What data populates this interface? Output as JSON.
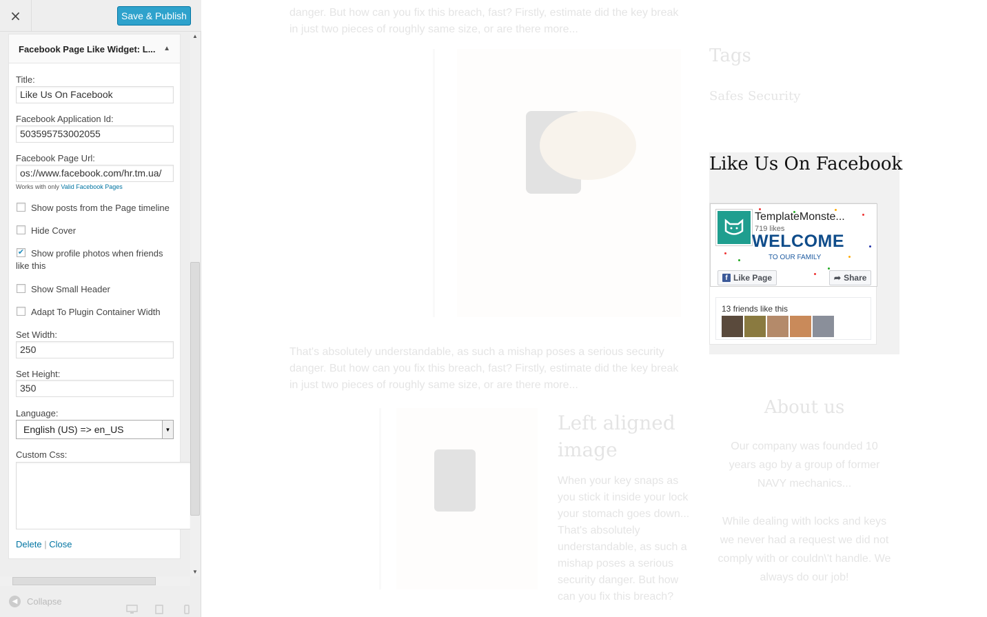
{
  "header": {
    "close_icon": "×",
    "save_label": "Save & Publish"
  },
  "widget": {
    "title": "Facebook Page Like Widget: L...",
    "toggle_icon": "▲",
    "fields": {
      "title_label": "Title:",
      "title_value": "Like Us On Facebook",
      "app_id_label": "Facebook Application Id:",
      "app_id_value": "503595753002055",
      "page_url_label": "Facebook Page Url:",
      "page_url_value": "os://www.facebook.com/hr.tm.ua/",
      "note_prefix": "Works with only",
      "note_link": "Valid Facebook Pages",
      "width_label": "Set Width:",
      "width_value": "250",
      "height_label": "Set Height:",
      "height_value": "350",
      "language_label": "Language:",
      "language_value": "English (US) => en_US",
      "custom_css_label": "Custom Css:"
    },
    "checkboxes": [
      {
        "label": "Show posts from the Page timeline",
        "checked": false
      },
      {
        "label": "Hide Cover",
        "checked": false
      },
      {
        "label": "Show profile photos when friends like this",
        "checked": true
      },
      {
        "label": "Show Small Header",
        "checked": false
      },
      {
        "label": "Adapt To Plugin Container Width",
        "checked": false
      }
    ],
    "actions": {
      "delete": "Delete",
      "separator": "|",
      "close": "Close"
    }
  },
  "footer": {
    "collapse_label": "Collapse",
    "device_icons": [
      "desktop-icon",
      "tablet-icon",
      "mobile-icon"
    ]
  },
  "preview": {
    "top_paragraph": "danger. But how can you fix this breach, fast? Firstly, estimate did the key break in just two pieces of roughly same size, or are there more...",
    "mid_paragraph": "That's absolutely understandable, as such a mishap poses a serious security danger. But how can you fix this breach, fast? Firstly, estimate did the key break in just two pieces of roughly same size, or are there more...",
    "left_aligned_title": "Left aligned image",
    "left_aligned_text": "When your key snaps as you stick it inside your lock your stomach goes down... That's absolutely understandable, as such a mishap poses a serious security danger. But how can you fix this breach?",
    "tags_title": "Tags",
    "tags": [
      "Safes",
      "Security"
    ],
    "fb_widget": {
      "heading": "Like Us On Facebook",
      "page_name": "TemplateMonste...",
      "likes": "719 likes",
      "cover_text": "WELCOME",
      "cover_subtext": "TO OUR FAMILY",
      "like_button": "Like Page",
      "share_button": "Share",
      "friends_text": "13 friends like this"
    },
    "about_title": "About us",
    "about_text_1": "Our company was founded 10 years ago by a group of former NAVY mechanics...",
    "about_text_2": "While dealing with locks and keys we never had a request we did not comply with or couldn\\'t handle. We always do our job!"
  },
  "colors": {
    "accent": "#2ea2cc",
    "link": "#0074a2",
    "panel_bg": "#eeeeee",
    "facebook_blue": "#3b5998"
  }
}
